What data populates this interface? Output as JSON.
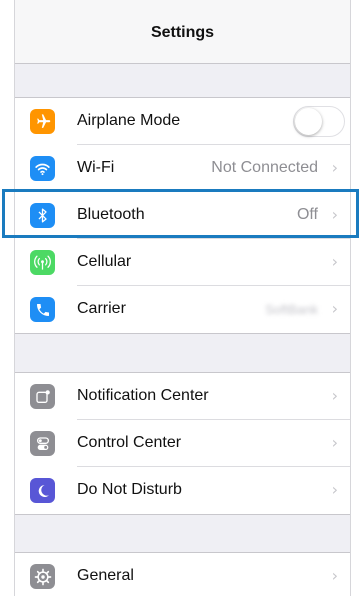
{
  "navbar": {
    "title": "Settings"
  },
  "group1": [
    {
      "label": "Airplane Mode",
      "icon": "airplane-icon",
      "color": "#ff9500",
      "control": "toggle",
      "toggle_on": false
    },
    {
      "label": "Wi-Fi",
      "icon": "wifi-icon",
      "color": "#1e8ef5",
      "value": "Not Connected"
    },
    {
      "label": "Bluetooth",
      "icon": "bluetooth-icon",
      "color": "#1e8ef5",
      "value": "Off",
      "highlighted": true
    },
    {
      "label": "Cellular",
      "icon": "cellular-antenna-icon",
      "color": "#4cd964",
      "value": ""
    },
    {
      "label": "Carrier",
      "icon": "phone-icon",
      "color": "#1e8ef5",
      "value": "SoftBank"
    }
  ],
  "group2": [
    {
      "label": "Notification Center",
      "icon": "notification-center-icon",
      "color": "#8e8e93"
    },
    {
      "label": "Control Center",
      "icon": "control-center-icon",
      "color": "#8e8e93"
    },
    {
      "label": "Do Not Disturb",
      "icon": "moon-icon",
      "color": "#5856d6"
    }
  ],
  "group3": [
    {
      "label": "General",
      "icon": "gear-icon",
      "color": "#8e8e93"
    }
  ],
  "highlight_color": "#1a7bbf"
}
